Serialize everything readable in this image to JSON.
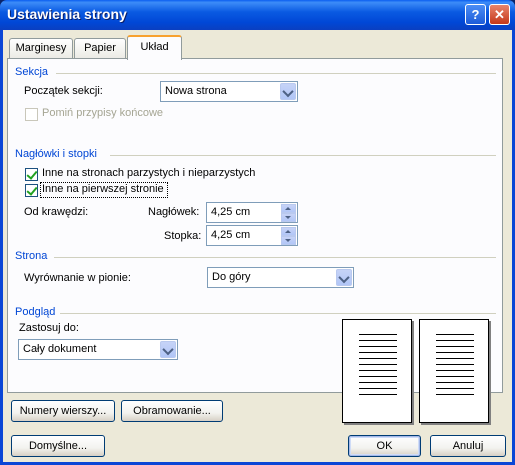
{
  "window": {
    "title": "Ustawienia strony",
    "help_glyph": "?",
    "close_glyph": "✕"
  },
  "tabs": [
    {
      "label": "Marginesy",
      "active": false
    },
    {
      "label": "Papier",
      "active": false
    },
    {
      "label": "Układ",
      "active": true
    }
  ],
  "sekcja": {
    "title": "Sekcja",
    "start_label": "Początek sekcji:",
    "start_value": "Nowa strona",
    "suppress_label": "Pomiń przypisy końcowe",
    "suppress_checked": false
  },
  "headers": {
    "title": "Nagłówki i stopki",
    "odd_even_label": "Inne na stronach parzystych i nieparzystych",
    "odd_even_checked": true,
    "first_page_label": "Inne na pierwszej stronie",
    "first_page_checked": true,
    "from_edge_label": "Od krawędzi:",
    "header_label": "Nagłówek:",
    "header_value": "4,25 cm",
    "footer_label": "Stopka:",
    "footer_value": "4,25 cm"
  },
  "strona": {
    "title": "Strona",
    "valign_label": "Wyrównanie w pionie:",
    "valign_value": "Do góry"
  },
  "preview": {
    "title": "Podgląd",
    "apply_label": "Zastosuj do:",
    "apply_value": "Cały dokument"
  },
  "buttons": {
    "line_numbers": "Numery wierszy...",
    "borders": "Obramowanie...",
    "default": "Domyślne...",
    "ok": "OK",
    "cancel": "Anuluj"
  },
  "colors": {
    "group_title": "#0046d5",
    "titlebar": "#0a5ae2",
    "checkmark": "#21a121"
  }
}
